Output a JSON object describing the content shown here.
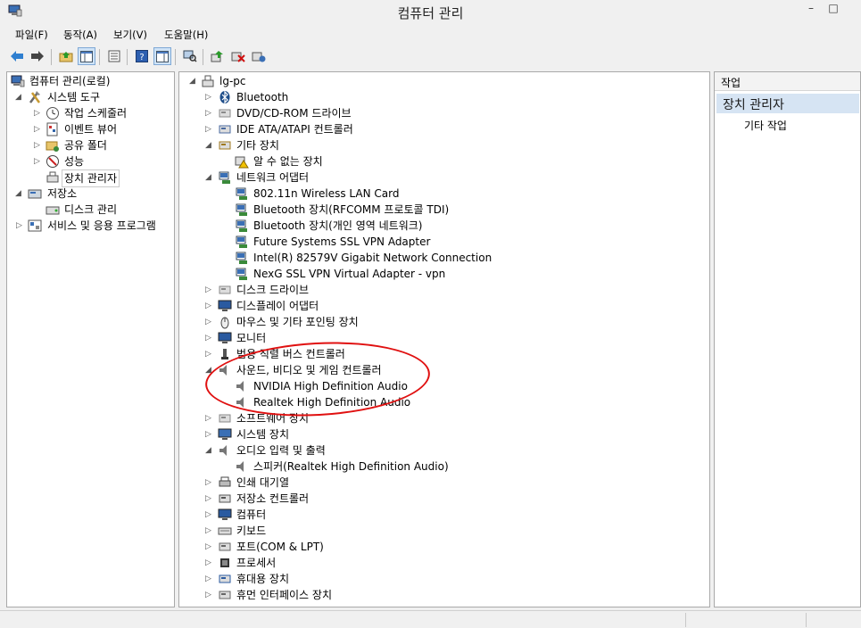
{
  "window": {
    "title": "컴퓨터 관리",
    "minimize_icon": "minimize-icon",
    "maximize_icon": "maximize-icon"
  },
  "menu": [
    "파일(F)",
    "동작(A)",
    "보기(V)",
    "도움말(H)"
  ],
  "toolbar_icons": [
    "back-arrow-icon",
    "forward-arrow-icon",
    "up-folder-icon",
    "show-hide-tree-icon",
    "properties-icon",
    "help-icon",
    "show-hide-action-pane-icon",
    "scan-hardware-icon",
    "update-driver-icon",
    "uninstall-device-icon",
    "enable-device-icon"
  ],
  "left_tree": {
    "root": "컴퓨터 관리(로컬)",
    "system_tools": "시스템 도구",
    "task_scheduler": "작업 스케줄러",
    "event_viewer": "이벤트 뷰어",
    "shared_folders": "공유 폴더",
    "performance": "성능",
    "device_manager": "장치 관리자",
    "storage": "저장소",
    "disk_management": "디스크 관리",
    "services_apps": "서비스 및 응용 프로그램"
  },
  "device_tree": {
    "root": "lg-pc",
    "items": [
      {
        "label": "Bluetooth",
        "level": 1,
        "expander": "collapsed",
        "icon": "bluetooth-icon"
      },
      {
        "label": "DVD/CD-ROM 드라이브",
        "level": 1,
        "expander": "collapsed",
        "icon": "dvd-drive-icon"
      },
      {
        "label": "IDE ATA/ATAPI 컨트롤러",
        "level": 1,
        "expander": "collapsed",
        "icon": "ide-controller-icon"
      },
      {
        "label": "기타 장치",
        "level": 1,
        "expander": "expanded",
        "icon": "other-devices-icon"
      },
      {
        "label": "알 수 없는 장치",
        "level": 2,
        "expander": "none",
        "icon": "unknown-device-warning-icon"
      },
      {
        "label": "네트워크 어댑터",
        "level": 1,
        "expander": "expanded",
        "icon": "network-adapter-icon"
      },
      {
        "label": "802.11n Wireless LAN Card",
        "level": 2,
        "expander": "none",
        "icon": "network-card-icon"
      },
      {
        "label": "Bluetooth 장치(RFCOMM 프로토콜 TDI)",
        "level": 2,
        "expander": "none",
        "icon": "network-card-icon"
      },
      {
        "label": "Bluetooth 장치(개인 영역 네트워크)",
        "level": 2,
        "expander": "none",
        "icon": "network-card-icon"
      },
      {
        "label": "Future Systems SSL VPN Adapter",
        "level": 2,
        "expander": "none",
        "icon": "network-card-icon"
      },
      {
        "label": "Intel(R) 82579V Gigabit Network Connection",
        "level": 2,
        "expander": "none",
        "icon": "network-card-icon"
      },
      {
        "label": "NexG SSL VPN Virtual Adapter - vpn",
        "level": 2,
        "expander": "none",
        "icon": "network-card-icon"
      },
      {
        "label": "디스크 드라이브",
        "level": 1,
        "expander": "collapsed",
        "icon": "disk-drive-icon"
      },
      {
        "label": "디스플레이 어댑터",
        "level": 1,
        "expander": "collapsed",
        "icon": "display-adapter-icon"
      },
      {
        "label": "마우스 및 기타 포인팅 장치",
        "level": 1,
        "expander": "collapsed",
        "icon": "mouse-icon"
      },
      {
        "label": "모니터",
        "level": 1,
        "expander": "collapsed",
        "icon": "monitor-icon"
      },
      {
        "label": "범용 직렬 버스 컨트롤러",
        "level": 1,
        "expander": "collapsed",
        "icon": "usb-controller-icon"
      },
      {
        "label": "사운드, 비디오 및 게임 컨트롤러",
        "level": 1,
        "expander": "expanded",
        "icon": "speaker-icon"
      },
      {
        "label": "NVIDIA High Definition Audio",
        "level": 2,
        "expander": "none",
        "icon": "speaker-icon"
      },
      {
        "label": "Realtek High Definition Audio",
        "level": 2,
        "expander": "none",
        "icon": "speaker-icon"
      },
      {
        "label": "소프트웨어 장치",
        "level": 1,
        "expander": "collapsed",
        "icon": "software-device-icon"
      },
      {
        "label": "시스템 장치",
        "level": 1,
        "expander": "collapsed",
        "icon": "system-device-icon"
      },
      {
        "label": "오디오 입력 및 출력",
        "level": 1,
        "expander": "expanded",
        "icon": "speaker-icon"
      },
      {
        "label": "스피커(Realtek High Definition Audio)",
        "level": 2,
        "expander": "none",
        "icon": "speaker-icon"
      },
      {
        "label": "인쇄 대기열",
        "level": 1,
        "expander": "collapsed",
        "icon": "printer-icon"
      },
      {
        "label": "저장소 컨트롤러",
        "level": 1,
        "expander": "collapsed",
        "icon": "storage-controller-icon"
      },
      {
        "label": "컴퓨터",
        "level": 1,
        "expander": "collapsed",
        "icon": "computer-icon"
      },
      {
        "label": "키보드",
        "level": 1,
        "expander": "collapsed",
        "icon": "keyboard-icon"
      },
      {
        "label": "포트(COM & LPT)",
        "level": 1,
        "expander": "collapsed",
        "icon": "port-icon"
      },
      {
        "label": "프로세서",
        "level": 1,
        "expander": "collapsed",
        "icon": "processor-icon"
      },
      {
        "label": "휴대용 장치",
        "level": 1,
        "expander": "collapsed",
        "icon": "portable-device-icon"
      },
      {
        "label": "휴먼 인터페이스 장치",
        "level": 1,
        "expander": "collapsed",
        "icon": "hid-icon"
      }
    ]
  },
  "actions": {
    "header": "작업",
    "section": "장치 관리자",
    "more": "기타 작업"
  },
  "colors": {
    "annotation_circle": "#e01010",
    "action_section_bg": "#d6e4f3",
    "selection_border": "#c9c9c9"
  }
}
